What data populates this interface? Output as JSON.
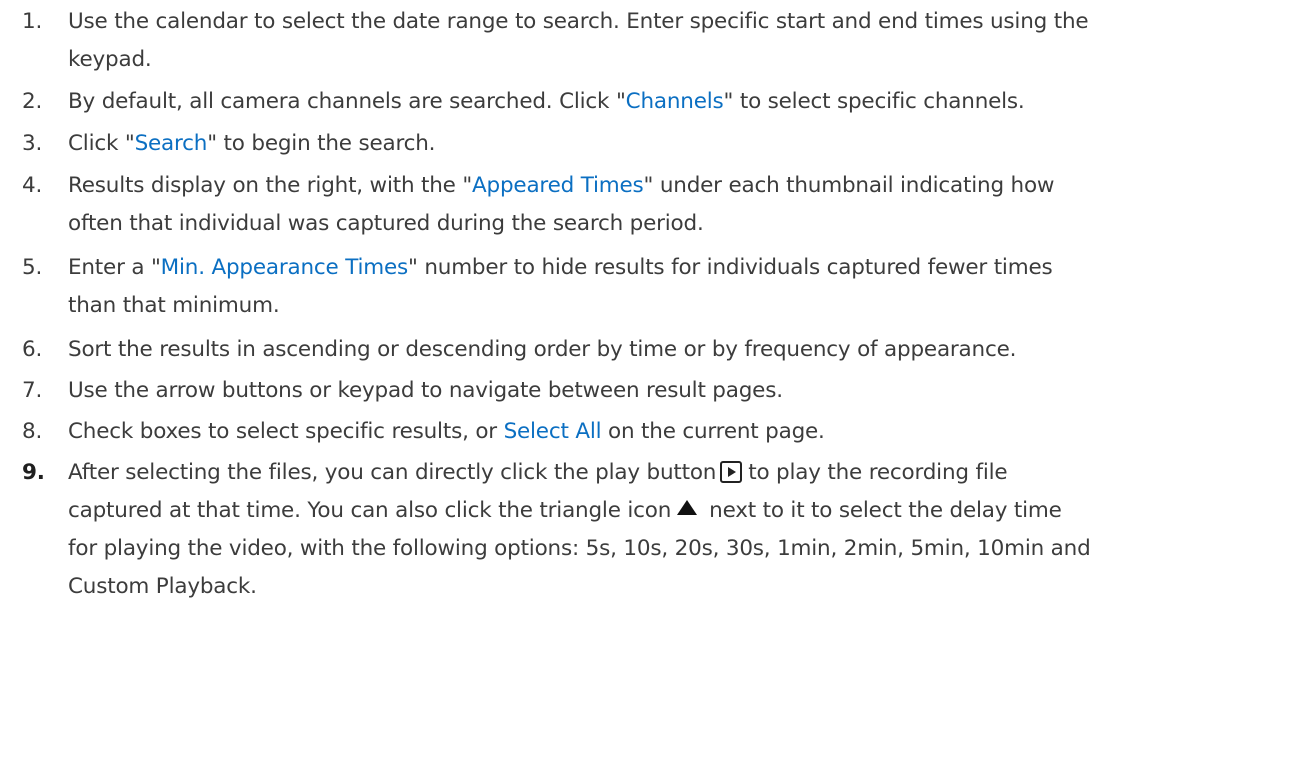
{
  "steps": [
    {
      "num": "1.",
      "lines": [
        "Use the calendar to select the date range to search. Enter specific start and end times using the",
        "keypad."
      ]
    },
    {
      "num": "2.",
      "pre": "By default, all camera channels are searched. Click \"",
      "hl": "Channels",
      "post": "\" to select specific channels."
    },
    {
      "num": "3.",
      "pre": "Click \"",
      "hl": "Search",
      "post": "\" to begin the search."
    },
    {
      "num": "4.",
      "pre": "Results display on the right, with the \"",
      "hl": "Appeared Times",
      "post": "\" under each thumbnail indicating how",
      "line2": "often that individual was captured during the search period."
    },
    {
      "num": "5.",
      "pre": "Enter a \"",
      "hl": "Min. Appearance Times",
      "post": "\" number to hide results for individuals captured fewer times",
      "line2": "than that minimum."
    },
    {
      "num": "6.",
      "text": "Sort the results in ascending or descending order by time or by frequency of appearance."
    },
    {
      "num": "7.",
      "text": "Use the arrow buttons or keypad to navigate between result pages."
    },
    {
      "num": "8.",
      "pre": "Check boxes to select specific results, or ",
      "hl": "Select All",
      "post": " on the current page."
    },
    {
      "num": "9.",
      "line1_pre": "After selecting the files, you can directly click the play button",
      "line1_post": "to play the recording file",
      "line2_pre": "captured at that time. You can also click the triangle icon",
      "line2_post": "next to it to select the delay time",
      "line3": "for playing the video, with the following options: 5s, 10s, 20s, 30s, 1min, 2min, 5min, 10min and",
      "line4": "Custom Playback.",
      "icons": [
        "play-icon",
        "triangle-up-icon"
      ]
    }
  ]
}
